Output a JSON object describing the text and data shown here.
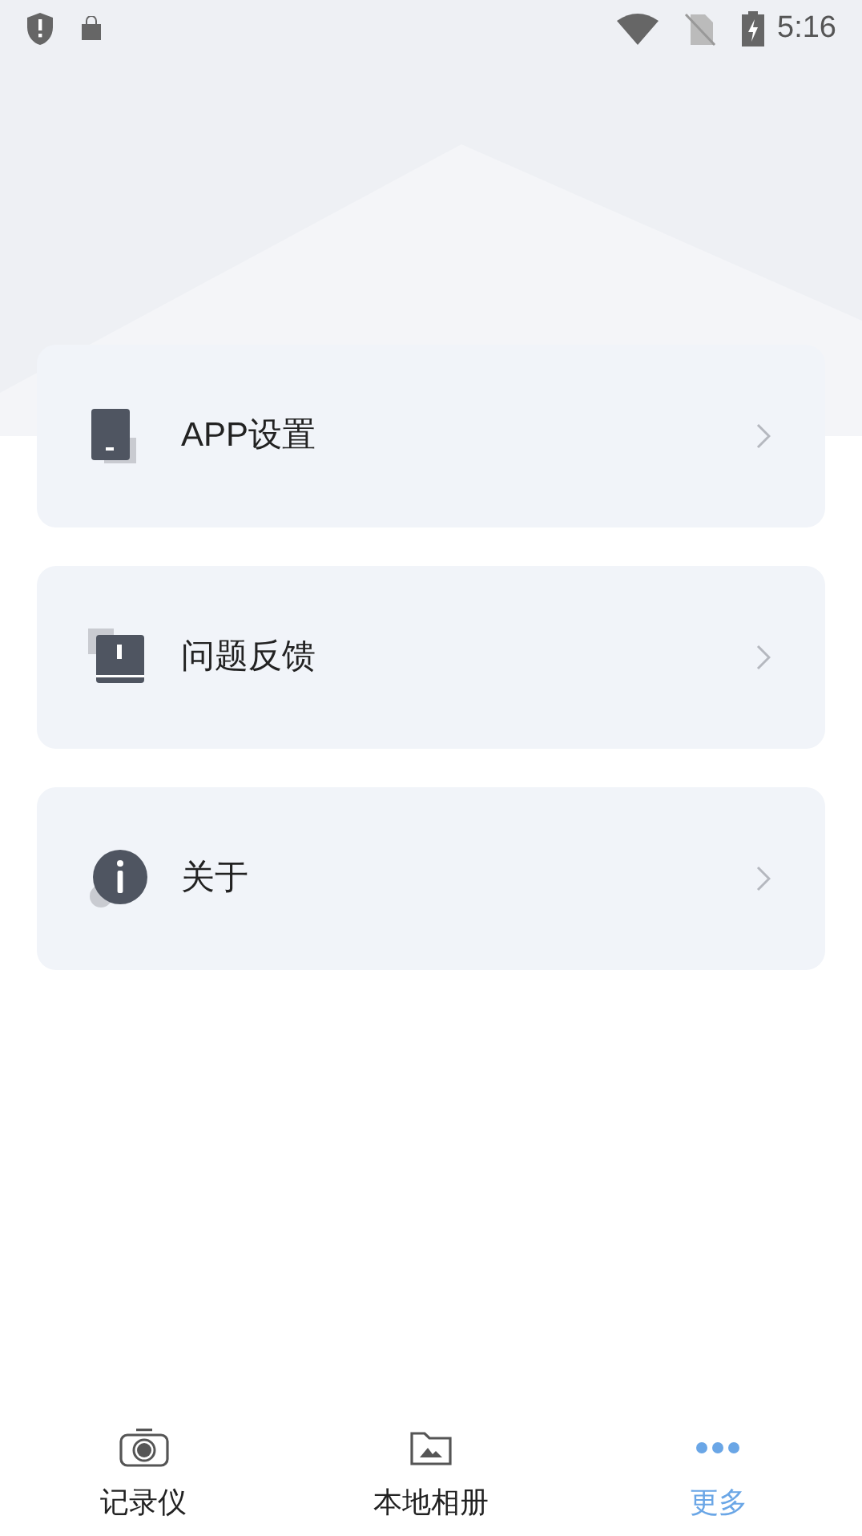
{
  "status_bar": {
    "time": "5:16"
  },
  "menu": [
    {
      "label": "APP设置",
      "kind": "settings"
    },
    {
      "label": "问题反馈",
      "kind": "feedback"
    },
    {
      "label": "关于",
      "kind": "about"
    }
  ],
  "tabs": [
    {
      "label": "记录仪",
      "kind": "camera",
      "selected": false
    },
    {
      "label": "本地相册",
      "kind": "album",
      "selected": false
    },
    {
      "label": "更多",
      "kind": "more",
      "selected": true
    }
  ]
}
